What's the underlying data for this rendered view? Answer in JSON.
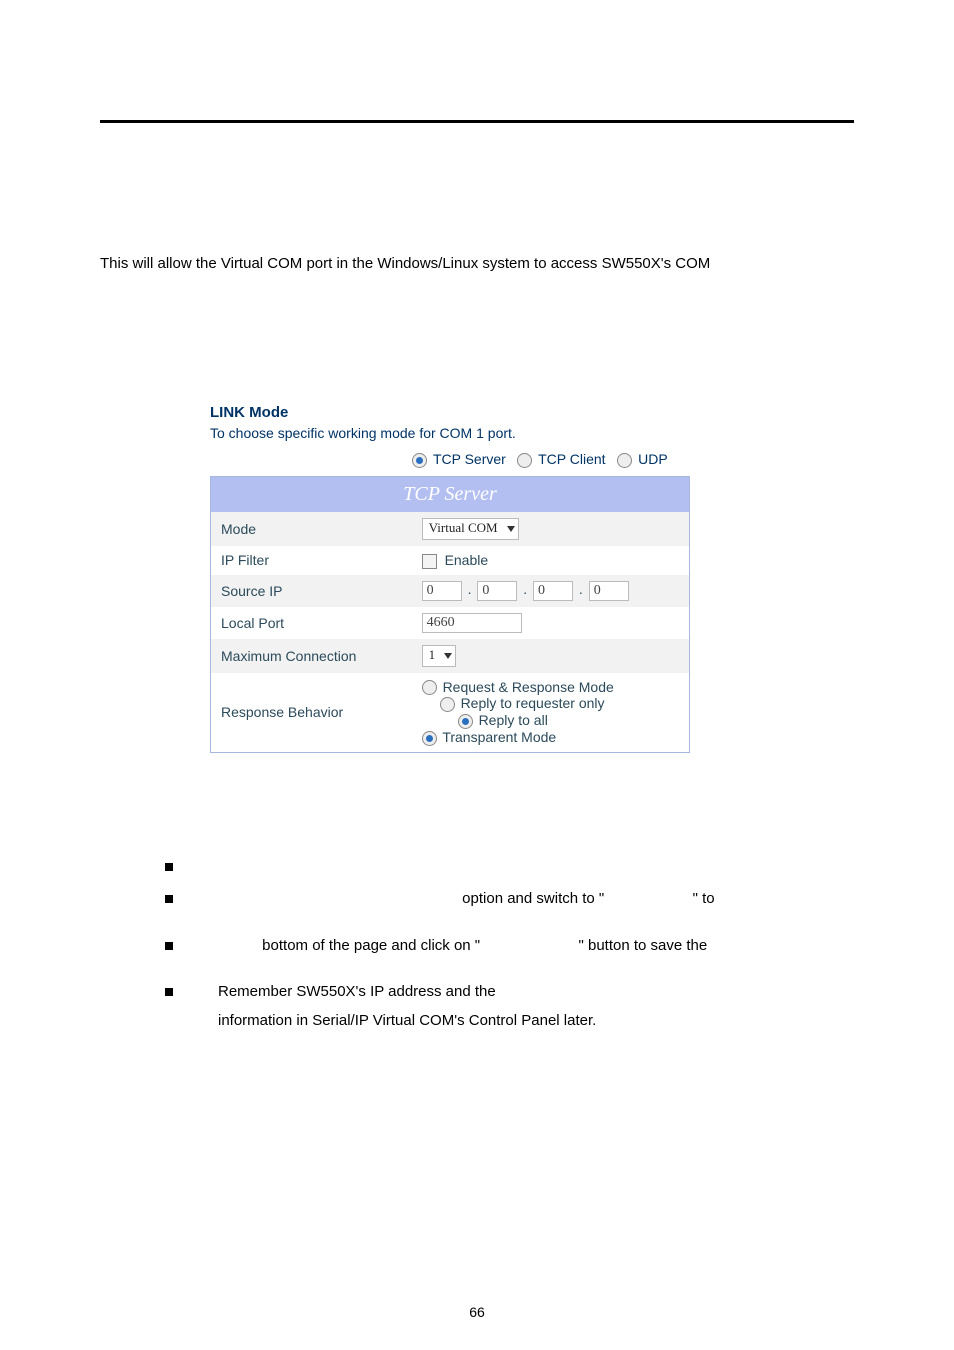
{
  "intro": "This will allow the Virtual COM port in the Windows/Linux system to access SW550X's COM",
  "link": {
    "title": "LINK Mode",
    "subtitle": "To choose specific working mode for COM 1 port."
  },
  "proto": {
    "tcp_server": "TCP Server",
    "tcp_client": "TCP Client",
    "udp": "UDP"
  },
  "table": {
    "header": "TCP Server",
    "rows": {
      "mode_label": "Mode",
      "mode_value": "Virtual COM",
      "ipfilter_label": "IP Filter",
      "ipfilter_value": "Enable",
      "sourceip_label": "Source IP",
      "sourceip": {
        "a": "0",
        "b": "0",
        "c": "0",
        "d": "0"
      },
      "localport_label": "Local Port",
      "localport_value": "4660",
      "maxconn_label": "Maximum Connection",
      "maxconn_value": "1",
      "resp_label": "Response Behavior",
      "resp_opts": {
        "req_resp": "Request & Response Mode",
        "reply_requester": "Reply to requester only",
        "reply_all": "Reply to all",
        "transparent": "Transparent Mode"
      }
    }
  },
  "bullets": {
    "b1_frag1": "option and switch to \"",
    "b1_frag2": "\" to",
    "b2_frag1": "bottom of the page and click on \"",
    "b2_frag2": "\" button to save the",
    "b3_line1": "Remember SW550X's IP address and the",
    "b3_line2": "information in Serial/IP Virtual COM's Control Panel later."
  },
  "page_number": "66"
}
